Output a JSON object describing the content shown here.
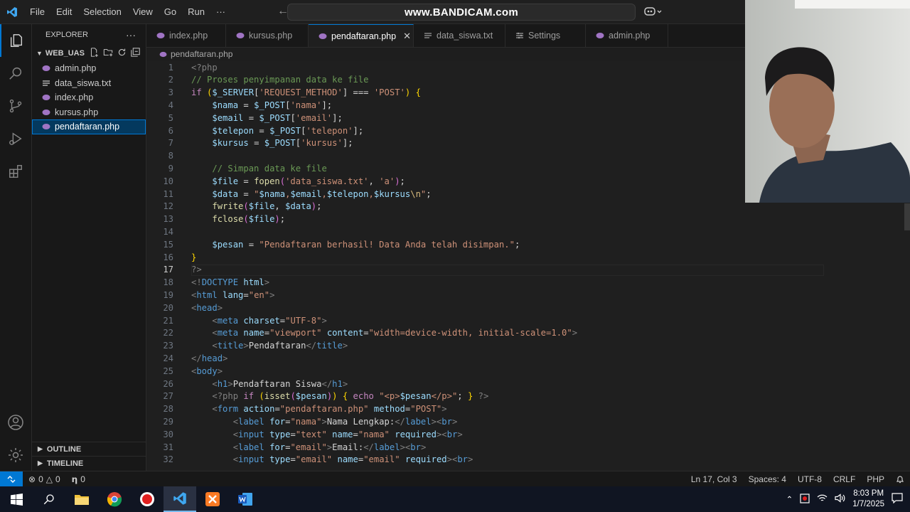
{
  "titlebar": {
    "menu": [
      "File",
      "Edit",
      "Selection",
      "View",
      "Go",
      "Run",
      "···"
    ],
    "watermark": "www.BANDICAM.com"
  },
  "sidebar": {
    "header": "EXPLORER",
    "folder": "WEB_UAS",
    "files": [
      {
        "name": "admin.php",
        "icon": "php-icon"
      },
      {
        "name": "data_siswa.txt",
        "icon": "text-file-icon"
      },
      {
        "name": "index.php",
        "icon": "php-icon"
      },
      {
        "name": "kursus.php",
        "icon": "php-icon"
      },
      {
        "name": "pendaftaran.php",
        "icon": "php-icon",
        "selected": true
      }
    ],
    "outline": "OUTLINE",
    "timeline": "TIMELINE"
  },
  "tabs": [
    {
      "label": "index.php",
      "icon": "php-icon"
    },
    {
      "label": "kursus.php",
      "icon": "php-icon"
    },
    {
      "label": "pendaftaran.php",
      "icon": "php-icon",
      "active": true
    },
    {
      "label": "data_siswa.txt",
      "icon": "text-file-icon"
    },
    {
      "label": "Settings",
      "icon": "settings-icon"
    },
    {
      "label": "admin.php",
      "icon": "php-icon"
    }
  ],
  "breadcrumb": "pendaftaran.php",
  "editor": {
    "current_line": 17,
    "lines": [
      [
        [
          "t-meta",
          "<?php"
        ]
      ],
      [
        [
          "t-com",
          "// Proses penyimpanan data ke file"
        ]
      ],
      [
        [
          "t-kw",
          "if "
        ],
        [
          "t-br",
          "("
        ],
        [
          "t-var",
          "$_SERVER"
        ],
        [
          "t-pl",
          "["
        ],
        [
          "t-str",
          "'REQUEST_METHOD'"
        ],
        [
          "t-pl",
          "] === "
        ],
        [
          "t-str",
          "'POST'"
        ],
        [
          "t-br",
          ")"
        ],
        [
          "t-pl",
          " "
        ],
        [
          "t-br",
          "{"
        ]
      ],
      [
        [
          "t-pl",
          "    "
        ],
        [
          "t-var",
          "$nama"
        ],
        [
          "t-pl",
          " = "
        ],
        [
          "t-var",
          "$_POST"
        ],
        [
          "t-pl",
          "["
        ],
        [
          "t-str",
          "'nama'"
        ],
        [
          "t-pl",
          "];"
        ]
      ],
      [
        [
          "t-pl",
          "    "
        ],
        [
          "t-var",
          "$email"
        ],
        [
          "t-pl",
          " = "
        ],
        [
          "t-var",
          "$_POST"
        ],
        [
          "t-pl",
          "["
        ],
        [
          "t-str",
          "'email'"
        ],
        [
          "t-pl",
          "];"
        ]
      ],
      [
        [
          "t-pl",
          "    "
        ],
        [
          "t-var",
          "$telepon"
        ],
        [
          "t-pl",
          " = "
        ],
        [
          "t-var",
          "$_POST"
        ],
        [
          "t-pl",
          "["
        ],
        [
          "t-str",
          "'telepon'"
        ],
        [
          "t-pl",
          "];"
        ]
      ],
      [
        [
          "t-pl",
          "    "
        ],
        [
          "t-var",
          "$kursus"
        ],
        [
          "t-pl",
          " = "
        ],
        [
          "t-var",
          "$_POST"
        ],
        [
          "t-pl",
          "["
        ],
        [
          "t-str",
          "'kursus'"
        ],
        [
          "t-pl",
          "];"
        ]
      ],
      [],
      [
        [
          "t-pl",
          "    "
        ],
        [
          "t-com",
          "// Simpan data ke file"
        ]
      ],
      [
        [
          "t-pl",
          "    "
        ],
        [
          "t-var",
          "$file"
        ],
        [
          "t-pl",
          " = "
        ],
        [
          "t-fn",
          "fopen"
        ],
        [
          "t-br2",
          "("
        ],
        [
          "t-str",
          "'data_siswa.txt'"
        ],
        [
          "t-pl",
          ", "
        ],
        [
          "t-str",
          "'a'"
        ],
        [
          "t-br2",
          ")"
        ],
        [
          "t-pl",
          ";"
        ]
      ],
      [
        [
          "t-pl",
          "    "
        ],
        [
          "t-var",
          "$data"
        ],
        [
          "t-pl",
          " = "
        ],
        [
          "t-str",
          "\""
        ],
        [
          "t-var",
          "$nama"
        ],
        [
          "t-str",
          ","
        ],
        [
          "t-var",
          "$email"
        ],
        [
          "t-str",
          ","
        ],
        [
          "t-var",
          "$telepon"
        ],
        [
          "t-str",
          ","
        ],
        [
          "t-var",
          "$kursus"
        ],
        [
          "t-esc",
          "\\n"
        ],
        [
          "t-str",
          "\""
        ],
        [
          "t-pl",
          ";"
        ]
      ],
      [
        [
          "t-pl",
          "    "
        ],
        [
          "t-fn",
          "fwrite"
        ],
        [
          "t-br2",
          "("
        ],
        [
          "t-var",
          "$file"
        ],
        [
          "t-pl",
          ", "
        ],
        [
          "t-var",
          "$data"
        ],
        [
          "t-br2",
          ")"
        ],
        [
          "t-pl",
          ";"
        ]
      ],
      [
        [
          "t-pl",
          "    "
        ],
        [
          "t-fn",
          "fclose"
        ],
        [
          "t-br2",
          "("
        ],
        [
          "t-var",
          "$file"
        ],
        [
          "t-br2",
          ")"
        ],
        [
          "t-pl",
          ";"
        ]
      ],
      [],
      [
        [
          "t-pl",
          "    "
        ],
        [
          "t-var",
          "$pesan"
        ],
        [
          "t-pl",
          " = "
        ],
        [
          "t-str",
          "\"Pendaftaran berhasil! Data Anda telah disimpan.\""
        ],
        [
          "t-pl",
          ";"
        ]
      ],
      [
        [
          "t-br",
          "}"
        ]
      ],
      [
        [
          "t-meta",
          "?>"
        ]
      ],
      [
        [
          "t-meta",
          "<!"
        ],
        [
          "t-tag",
          "DOCTYPE"
        ],
        [
          "t-pl",
          " "
        ],
        [
          "t-attr",
          "html"
        ],
        [
          "t-meta",
          ">"
        ]
      ],
      [
        [
          "t-meta",
          "<"
        ],
        [
          "t-tag",
          "html"
        ],
        [
          "t-pl",
          " "
        ],
        [
          "t-attr",
          "lang"
        ],
        [
          "t-pl",
          "="
        ],
        [
          "t-str",
          "\"en\""
        ],
        [
          "t-meta",
          ">"
        ]
      ],
      [
        [
          "t-meta",
          "<"
        ],
        [
          "t-tag",
          "head"
        ],
        [
          "t-meta",
          ">"
        ]
      ],
      [
        [
          "t-pl",
          "    "
        ],
        [
          "t-meta",
          "<"
        ],
        [
          "t-tag",
          "meta"
        ],
        [
          "t-pl",
          " "
        ],
        [
          "t-attr",
          "charset"
        ],
        [
          "t-pl",
          "="
        ],
        [
          "t-str",
          "\"UTF-8\""
        ],
        [
          "t-meta",
          ">"
        ]
      ],
      [
        [
          "t-pl",
          "    "
        ],
        [
          "t-meta",
          "<"
        ],
        [
          "t-tag",
          "meta"
        ],
        [
          "t-pl",
          " "
        ],
        [
          "t-attr",
          "name"
        ],
        [
          "t-pl",
          "="
        ],
        [
          "t-str",
          "\"viewport\""
        ],
        [
          "t-pl",
          " "
        ],
        [
          "t-attr",
          "content"
        ],
        [
          "t-pl",
          "="
        ],
        [
          "t-str",
          "\"width=device-width, initial-scale=1.0\""
        ],
        [
          "t-meta",
          ">"
        ]
      ],
      [
        [
          "t-pl",
          "    "
        ],
        [
          "t-meta",
          "<"
        ],
        [
          "t-tag",
          "title"
        ],
        [
          "t-meta",
          ">"
        ],
        [
          "t-pl",
          "Pendaftaran"
        ],
        [
          "t-meta",
          "</"
        ],
        [
          "t-tag",
          "title"
        ],
        [
          "t-meta",
          ">"
        ]
      ],
      [
        [
          "t-meta",
          "</"
        ],
        [
          "t-tag",
          "head"
        ],
        [
          "t-meta",
          ">"
        ]
      ],
      [
        [
          "t-meta",
          "<"
        ],
        [
          "t-tag",
          "body"
        ],
        [
          "t-meta",
          ">"
        ]
      ],
      [
        [
          "t-pl",
          "    "
        ],
        [
          "t-meta",
          "<"
        ],
        [
          "t-tag",
          "h1"
        ],
        [
          "t-meta",
          ">"
        ],
        [
          "t-pl",
          "Pendaftaran Siswa"
        ],
        [
          "t-meta",
          "</"
        ],
        [
          "t-tag",
          "h1"
        ],
        [
          "t-meta",
          ">"
        ]
      ],
      [
        [
          "t-pl",
          "    "
        ],
        [
          "t-meta",
          "<?php "
        ],
        [
          "t-kw",
          "if "
        ],
        [
          "t-br",
          "("
        ],
        [
          "t-fn",
          "isset"
        ],
        [
          "t-br2",
          "("
        ],
        [
          "t-var",
          "$pesan"
        ],
        [
          "t-br2",
          ")"
        ],
        [
          "t-br",
          ")"
        ],
        [
          "t-pl",
          " "
        ],
        [
          "t-br",
          "{"
        ],
        [
          "t-pl",
          " "
        ],
        [
          "t-kw",
          "echo "
        ],
        [
          "t-str",
          "\"<p>"
        ],
        [
          "t-var",
          "$pesan"
        ],
        [
          "t-str",
          "</p>\""
        ],
        [
          "t-pl",
          "; "
        ],
        [
          "t-br",
          "}"
        ],
        [
          "t-pl",
          " "
        ],
        [
          "t-meta",
          "?>"
        ]
      ],
      [
        [
          "t-pl",
          "    "
        ],
        [
          "t-meta",
          "<"
        ],
        [
          "t-tag",
          "form"
        ],
        [
          "t-pl",
          " "
        ],
        [
          "t-attr",
          "action"
        ],
        [
          "t-pl",
          "="
        ],
        [
          "t-str",
          "\"pendaftaran.php\""
        ],
        [
          "t-pl",
          " "
        ],
        [
          "t-attr",
          "method"
        ],
        [
          "t-pl",
          "="
        ],
        [
          "t-str",
          "\"POST\""
        ],
        [
          "t-meta",
          ">"
        ]
      ],
      [
        [
          "t-pl",
          "        "
        ],
        [
          "t-meta",
          "<"
        ],
        [
          "t-tag",
          "label"
        ],
        [
          "t-pl",
          " "
        ],
        [
          "t-attr",
          "for"
        ],
        [
          "t-pl",
          "="
        ],
        [
          "t-str",
          "\"nama\""
        ],
        [
          "t-meta",
          ">"
        ],
        [
          "t-pl",
          "Nama Lengkap:"
        ],
        [
          "t-meta",
          "</"
        ],
        [
          "t-tag",
          "label"
        ],
        [
          "t-meta",
          "><"
        ],
        [
          "t-tag",
          "br"
        ],
        [
          "t-meta",
          ">"
        ]
      ],
      [
        [
          "t-pl",
          "        "
        ],
        [
          "t-meta",
          "<"
        ],
        [
          "t-tag",
          "input"
        ],
        [
          "t-pl",
          " "
        ],
        [
          "t-attr",
          "type"
        ],
        [
          "t-pl",
          "="
        ],
        [
          "t-str",
          "\"text\""
        ],
        [
          "t-pl",
          " "
        ],
        [
          "t-attr",
          "name"
        ],
        [
          "t-pl",
          "="
        ],
        [
          "t-str",
          "\"nama\""
        ],
        [
          "t-pl",
          " "
        ],
        [
          "t-attr",
          "required"
        ],
        [
          "t-meta",
          "><"
        ],
        [
          "t-tag",
          "br"
        ],
        [
          "t-meta",
          ">"
        ]
      ],
      [
        [
          "t-pl",
          "        "
        ],
        [
          "t-meta",
          "<"
        ],
        [
          "t-tag",
          "label"
        ],
        [
          "t-pl",
          " "
        ],
        [
          "t-attr",
          "for"
        ],
        [
          "t-pl",
          "="
        ],
        [
          "t-str",
          "\"email\""
        ],
        [
          "t-meta",
          ">"
        ],
        [
          "t-pl",
          "Email:"
        ],
        [
          "t-meta",
          "</"
        ],
        [
          "t-tag",
          "label"
        ],
        [
          "t-meta",
          "><"
        ],
        [
          "t-tag",
          "br"
        ],
        [
          "t-meta",
          ">"
        ]
      ],
      [
        [
          "t-pl",
          "        "
        ],
        [
          "t-meta",
          "<"
        ],
        [
          "t-tag",
          "input"
        ],
        [
          "t-pl",
          " "
        ],
        [
          "t-attr",
          "type"
        ],
        [
          "t-pl",
          "="
        ],
        [
          "t-str",
          "\"email\""
        ],
        [
          "t-pl",
          " "
        ],
        [
          "t-attr",
          "name"
        ],
        [
          "t-pl",
          "="
        ],
        [
          "t-str",
          "\"email\""
        ],
        [
          "t-pl",
          " "
        ],
        [
          "t-attr",
          "required"
        ],
        [
          "t-meta",
          "><"
        ],
        [
          "t-tag",
          "br"
        ],
        [
          "t-meta",
          ">"
        ]
      ]
    ]
  },
  "status": {
    "errors": "0",
    "warnings": "0",
    "ports": "0",
    "position": "Ln 17, Col 3",
    "spaces": "Spaces: 4",
    "encoding": "UTF-8",
    "eol": "CRLF",
    "language": "PHP"
  },
  "taskbar": {
    "time": "8:03 PM",
    "date": "1/7/2025"
  },
  "colors": {
    "accent": "#0078d4",
    "php_icon": "#a074c4"
  }
}
